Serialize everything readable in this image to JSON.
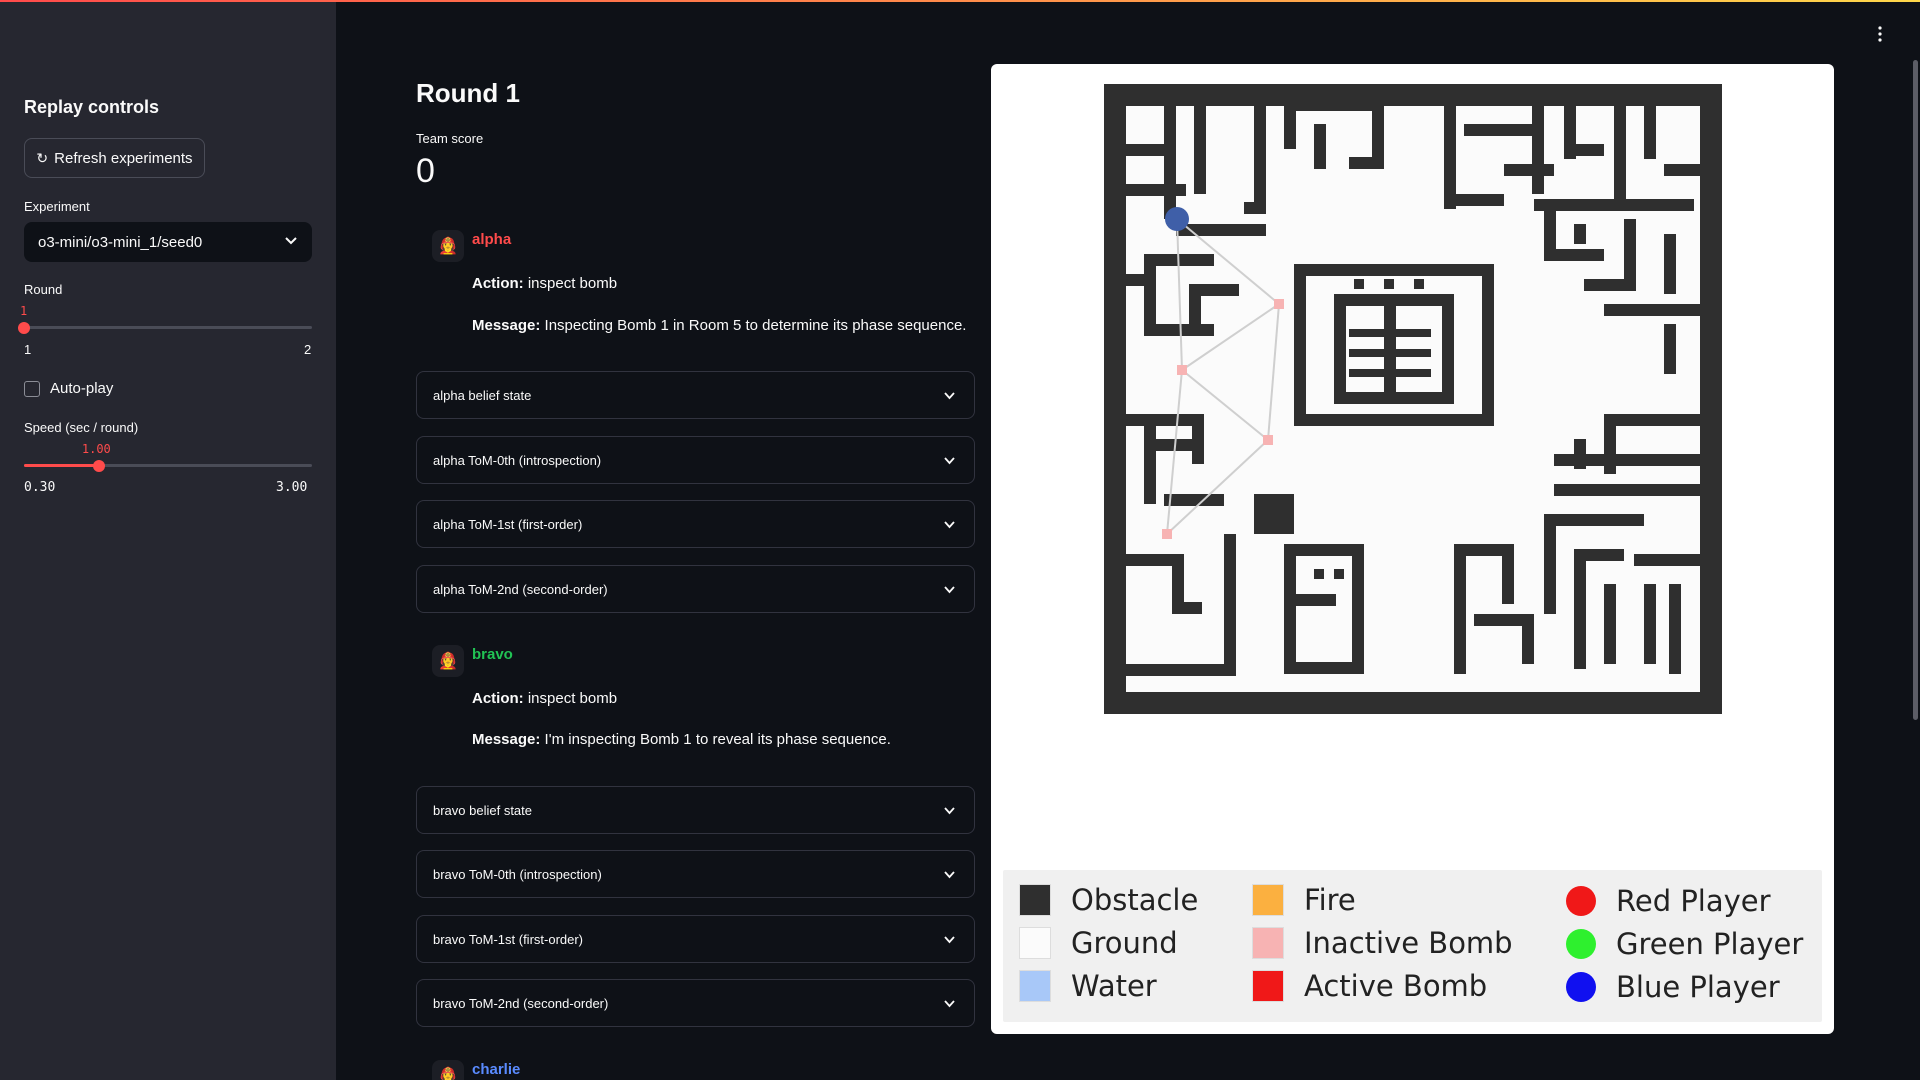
{
  "sidebar": {
    "title": "Replay controls",
    "refresh_label": "Refresh experiments",
    "experiment_label": "Experiment",
    "experiment_value": "o3-mini/o3-mini_1/seed0",
    "round_label": "Round",
    "round_value": "1",
    "round_min": "1",
    "round_max": "2",
    "round_fraction": 0,
    "autoplay_label": "Auto-play",
    "autoplay_checked": false,
    "speed_label": "Speed (sec / round)",
    "speed_value": "1.00",
    "speed_min": "0.30",
    "speed_max": "3.00",
    "speed_fraction": 0.26
  },
  "main": {
    "round_title": "Round 1",
    "score_label": "Team score",
    "score_value": "0",
    "agents": [
      {
        "name": "alpha",
        "color": "#ff4b4b",
        "avatar": "👩‍🚒",
        "action_label": "Action:",
        "action": "inspect bomb",
        "message_label": "Message:",
        "message": "Inspecting Bomb 1 in Room 5 to determine its phase sequence."
      },
      {
        "name": "bravo",
        "color": "#21c354",
        "avatar": "👩‍🚒",
        "action_label": "Action:",
        "action": "inspect bomb",
        "message_label": "Message:",
        "message": "I'm inspecting Bomb 1 to reveal its phase sequence."
      },
      {
        "name": "charlie",
        "color": "#5a8bff",
        "avatar": "👩‍🚒"
      }
    ],
    "expanders": {
      "alpha": [
        "alpha belief state",
        "alpha ToM-0th (introspection)",
        "alpha ToM-1st (first-order)",
        "alpha ToM-2nd (second-order)"
      ],
      "bravo": [
        "bravo belief state",
        "bravo ToM-0th (introspection)",
        "bravo ToM-1st (first-order)",
        "bravo ToM-2nd (second-order)"
      ]
    }
  },
  "legend": [
    {
      "label": "Obstacle",
      "color": "#2f2f2f",
      "shape": "square"
    },
    {
      "label": "Ground",
      "color": "#fbfbfb",
      "shape": "square"
    },
    {
      "label": "Water",
      "color": "#a8c8f8",
      "shape": "square"
    },
    {
      "label": "Fire",
      "color": "#fbb040",
      "shape": "square"
    },
    {
      "label": "Inactive Bomb",
      "color": "#f7b3b3",
      "shape": "square"
    },
    {
      "label": "Active Bomb",
      "color": "#f01818",
      "shape": "square"
    },
    {
      "label": "Red Player",
      "color": "#f01818",
      "shape": "circle"
    },
    {
      "label": "Green Player",
      "color": "#2ef02e",
      "shape": "circle"
    },
    {
      "label": "Blue Player",
      "color": "#1010f0",
      "shape": "circle"
    }
  ],
  "icons": {
    "refresh": "refresh-icon",
    "chevron": "chevron-down-icon",
    "menu": "more-vert-icon"
  }
}
